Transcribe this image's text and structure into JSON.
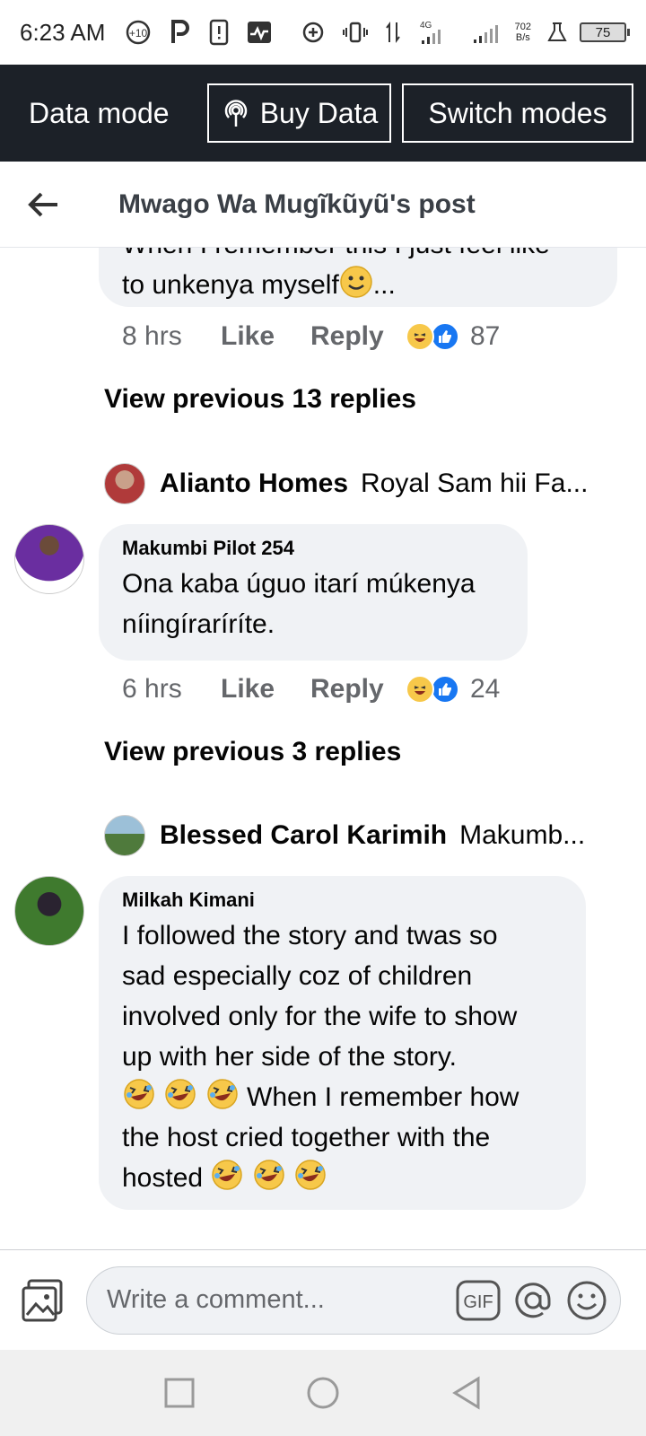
{
  "status_bar": {
    "time": "6:23 AM",
    "badge": "+10",
    "net_speed_value": "702",
    "net_speed_unit": "B/s",
    "network": "4G",
    "battery": "75"
  },
  "data_mode": {
    "label": "Data mode",
    "buy_label": "Buy Data",
    "switch_label": "Switch modes"
  },
  "header": {
    "title": "Mwago Wa Mugĩkũyũ's post"
  },
  "comments": [
    {
      "text_partial": "When I remember this I just feel like",
      "text": "to unkenya myself",
      "ellipsis": "...",
      "time": "8 hrs",
      "like": "Like",
      "reply": "Reply",
      "reactions": "87",
      "view_previous": "View previous 13 replies",
      "latest_reply": {
        "name": "Alianto Homes",
        "snippet": "Royal Sam hii Fa..."
      }
    },
    {
      "author": "Makumbi Pilot 254",
      "text_line1": "Ona kaba úguo itarí múkenya",
      "text_line2": "níingíraríríte.",
      "time": "6 hrs",
      "like": "Like",
      "reply": "Reply",
      "reactions": "24",
      "view_previous": "View previous 3 replies",
      "latest_reply": {
        "name": "Blessed Carol Karimih",
        "snippet": "Makumb..."
      }
    },
    {
      "author": "Milkah Kimani",
      "line1": "I followed the story and twas so",
      "line2": "sad especially coz of children",
      "line3": "involved only for the wife to show",
      "line4": "up with her side of the story.",
      "line5": "When I remember how",
      "line6": "the host cried together with the",
      "line7": "hosted"
    }
  ],
  "composer": {
    "placeholder": "Write a comment...",
    "gif_label": "GIF"
  },
  "colors": {
    "data_bar_bg": "#1c2128",
    "bubble_bg": "#f0f2f5",
    "like_blue": "#1877f2",
    "haha_yellow": "#f7c84a"
  }
}
